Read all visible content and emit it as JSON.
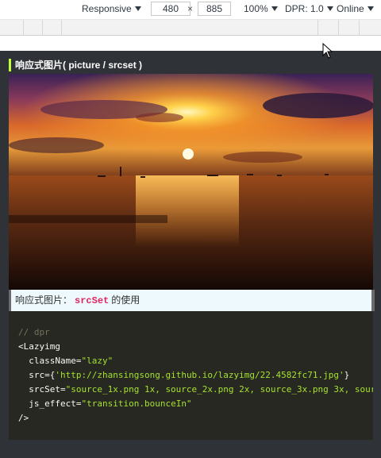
{
  "devtools": {
    "device": "Responsive",
    "width": "480",
    "multiply": "×",
    "height": "885",
    "zoom": "100%",
    "dpr": "DPR: 1.0",
    "network": "Online"
  },
  "page": {
    "section_title": "响应式图片( picture / srcset )",
    "caption_prefix": "响应式图片：",
    "caption_code": "srcSet",
    "caption_suffix": "的使用"
  },
  "code": {
    "comment": "// dpr",
    "tag_open": "<Lazyimg",
    "class_attr": "className=",
    "class_val": "\"lazy\"",
    "src_attr": "src={",
    "src_val": "'http://zhansingsong.github.io/lazyimg/22.4582fc71.jpg'",
    "src_close": "}",
    "srcset_attr": "srcSet=",
    "srcset_val": "\"source_1x.png 1x, source_2x.png 2x, source_3x.png 3x, sour",
    "effect_attr": "js_effect=",
    "effect_val": "\"transition.bounceIn\"",
    "tag_close": "/>"
  },
  "icons": {
    "cursor": "mouse-pointer-icon",
    "dropdown": "triangle-down-icon"
  },
  "colors": {
    "title_accent": "#c0ff3e",
    "page_bg": "#2f3237",
    "code_bg": "#272822",
    "string": "#a6e22e",
    "inline_code": "#e0245e"
  }
}
